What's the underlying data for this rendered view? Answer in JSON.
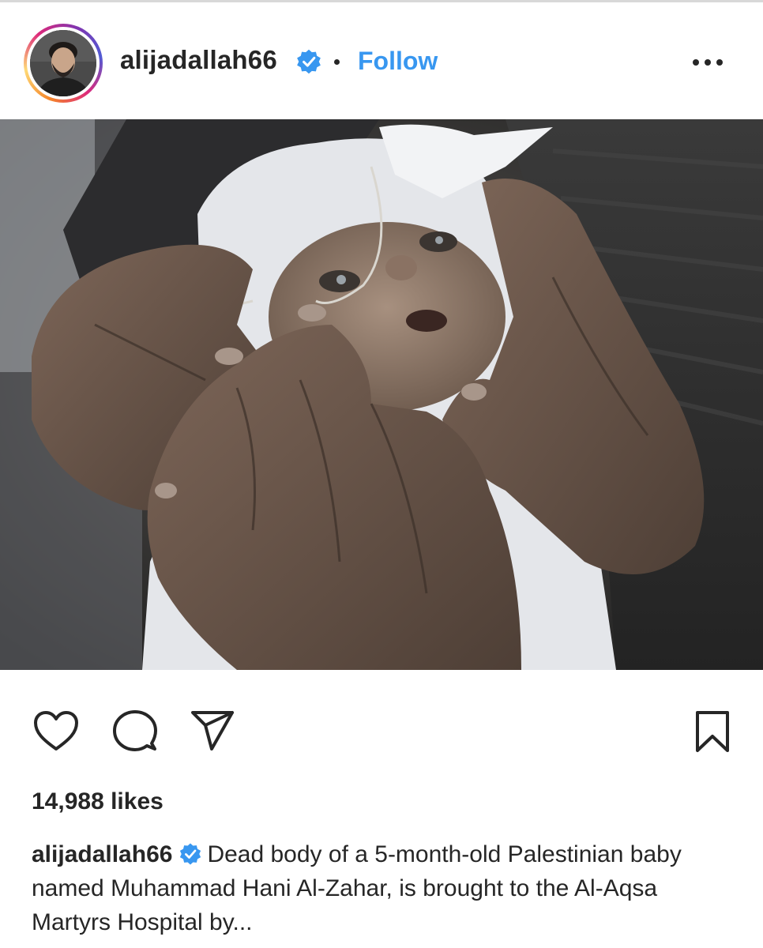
{
  "post": {
    "username": "alijadallah66",
    "follow_label": "Follow",
    "likes": "14,988 likes",
    "caption_username": "alijadallah66",
    "caption_text": "Dead body of a 5-month-old Palestinian baby named Muhammad Hani Al-Zahar, is brought to the Al-Aqsa Martyrs Hospital by..."
  },
  "icons": {
    "verified": "verified-badge-icon",
    "more": "more-options-icon",
    "like": "heart-icon",
    "comment": "comment-icon",
    "share": "share-icon",
    "save": "bookmark-icon"
  },
  "colors": {
    "accent": "#3897f0",
    "verified": "#3897f0",
    "text": "#262626"
  }
}
